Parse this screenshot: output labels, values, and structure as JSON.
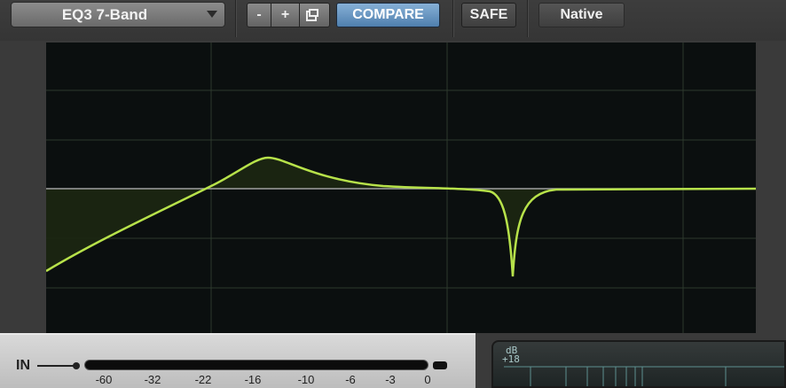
{
  "toolbar": {
    "preset_name": "EQ3 7-Band",
    "minus_label": "-",
    "plus_label": "+",
    "compare_label": "COMPARE",
    "safe_label": "SAFE",
    "native_label": "Native",
    "icons": {
      "preset_dropdown": "chevron-down-icon",
      "copy_settings": "copy-icon"
    }
  },
  "graph": {
    "grid_color": "#2e3a2e",
    "curve_color": "#b7e24a",
    "fill_color": "#1b2612",
    "zero_line_color": "#a0a0a0"
  },
  "input_meter": {
    "label": "IN",
    "ticks": [
      "-60",
      "-32",
      "-22",
      "-16",
      "-10",
      "-6",
      "-3",
      "0"
    ]
  },
  "db_scale": {
    "label": "dB",
    "top_value": "+18"
  },
  "colors": {
    "compare_accent": "#5a8bbd",
    "background": "#3a3a3a"
  }
}
